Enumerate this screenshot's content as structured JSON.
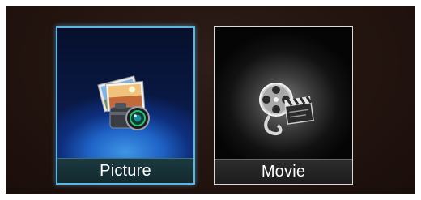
{
  "menu": {
    "items": [
      {
        "label": "Picture",
        "icon": "picture-icon",
        "selected": true,
        "accent": "#59b7e6"
      },
      {
        "label": "Movie",
        "icon": "movie-icon",
        "selected": false
      }
    ]
  }
}
